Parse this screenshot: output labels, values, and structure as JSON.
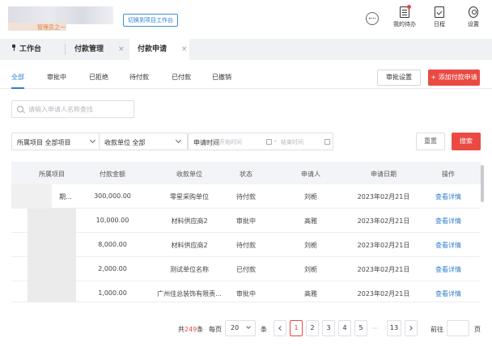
{
  "header": {
    "brand_sub": "管理员之一",
    "switch_label": "切换到项目工作台",
    "icons": [
      {
        "name": "my-todo",
        "label": "我的待办",
        "icon": "document-icon",
        "badge": true
      },
      {
        "name": "schedule",
        "label": "日程",
        "icon": "calendar-check-icon"
      },
      {
        "name": "settings",
        "label": "设置",
        "icon": "gear-icon"
      }
    ]
  },
  "tabs": [
    {
      "label": "工作台",
      "closable": false
    },
    {
      "label": "付款管理",
      "closable": true
    },
    {
      "label": "付款申请",
      "closable": true,
      "active": true
    }
  ],
  "status_tabs": [
    "全部",
    "审批中",
    "已拒绝",
    "待付款",
    "已付款",
    "已撤销"
  ],
  "actions": {
    "approve_settings": "审批设置",
    "add_payment": "+ 添加付款申请"
  },
  "search": {
    "placeholder": "请输入申请人名称查找"
  },
  "filters": {
    "project_label": "所属项目",
    "project_value": "全部项目",
    "payee_label": "收款单位",
    "payee_value": "全部",
    "date_label": "申请时间",
    "date_start": "开始时间",
    "date_sep": "-",
    "date_end": "结束时间",
    "reset": "重置",
    "search": "搜索"
  },
  "table": {
    "columns": [
      "所属项目",
      "付款金额",
      "收款单位",
      "状态",
      "申请人",
      "申请日期",
      "操作"
    ],
    "rows": [
      {
        "project": "期...",
        "amount": "300,000.00",
        "payee": "零星采购单位",
        "status": "待付款",
        "applicant": "刘栀",
        "date": "2023年02月21日",
        "action": "查看详情"
      },
      {
        "project": "",
        "amount": "10,000.00",
        "payee": "材料供应商2",
        "status": "审批中",
        "applicant": "高雅",
        "date": "2023年02月21日",
        "action": "查看详情"
      },
      {
        "project": "",
        "amount": "8,000.00",
        "payee": "材料供应商2",
        "status": "待付款",
        "applicant": "刘栀",
        "date": "2023年02月21日",
        "action": "查看详情"
      },
      {
        "project": "",
        "amount": "2,000.00",
        "payee": "测试单位名称",
        "status": "已付款",
        "applicant": "刘栀",
        "date": "2023年02月21日",
        "action": "查看详情"
      },
      {
        "project": "",
        "amount": "1,000.00",
        "payee": "广州佳总装饰有限责...",
        "status": "审批中",
        "applicant": "高雅",
        "date": "2023年02月21日",
        "action": "查看详情"
      }
    ]
  },
  "pagination": {
    "total_prefix": "共",
    "total": "249",
    "total_suffix": "条",
    "per_page_label": "每页",
    "per_page": "20",
    "per_page_suffix": "条",
    "pages": [
      "1",
      "2",
      "3",
      "4",
      "5"
    ],
    "ellipsis": "···",
    "last": "13",
    "goto_label": "前往",
    "goto_suffix": "页"
  }
}
